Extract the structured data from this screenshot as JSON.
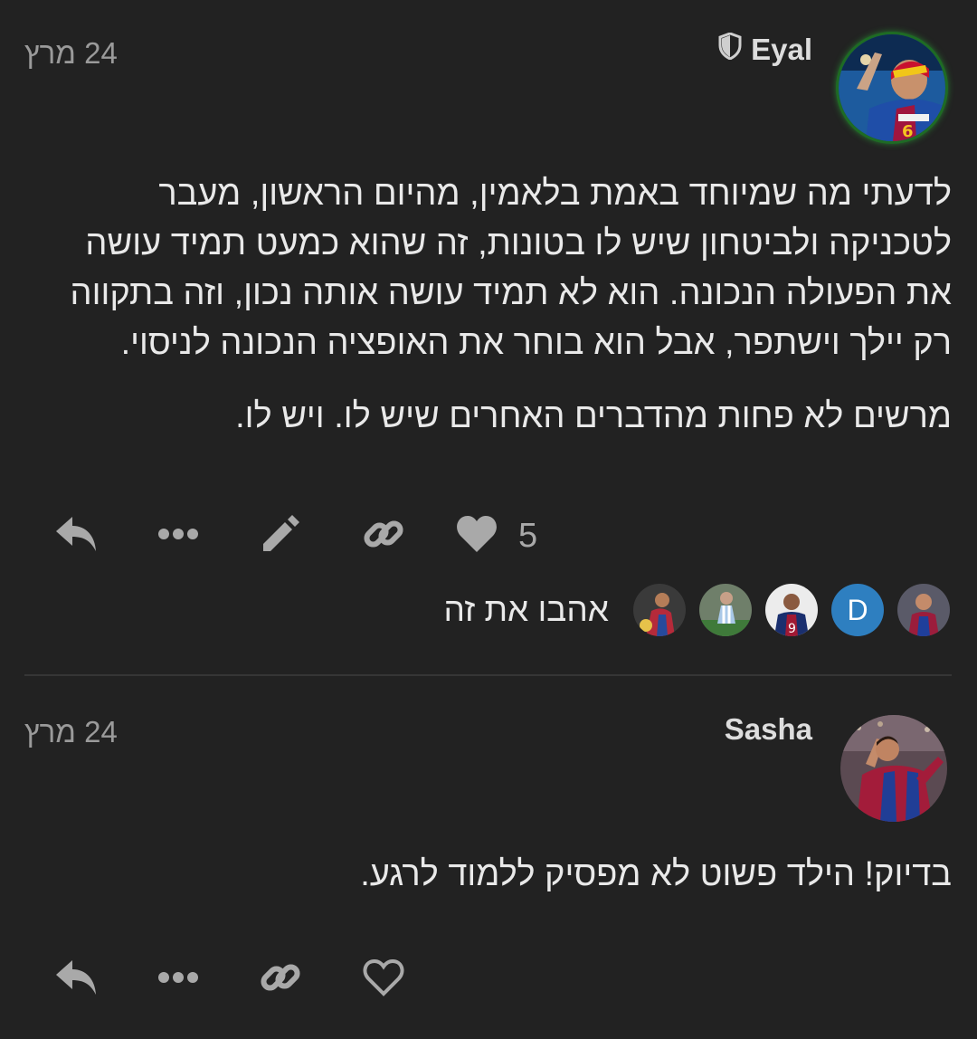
{
  "posts": [
    {
      "username": "Eyal",
      "badge_icon": "shield-icon",
      "date": "24 מרץ",
      "paragraphs": [
        "לדעתי מה שמיוחד באמת בלאמין, מהיום הראשון, מעבר לטכניקה ולביטחון שיש לו בטונות, זה שהוא כמעט תמיד עושה את הפעולה הנכונה. הוא לא תמיד עושה אותה נכון, וזה בתקווה רק יילך וישתפר, אבל הוא בוחר את האופציה הנכונה לניסוי.",
        "מרשים לא פחות מהדברים האחרים שיש לו. ויש לו."
      ],
      "like_count": "5",
      "likers_label": "אהבו את זה",
      "liker_initial": "D"
    },
    {
      "username": "Sasha",
      "date": "24 מרץ",
      "paragraphs": [
        "בדיוק! הילד פשוט לא מפסיק ללמוד לרגע."
      ]
    }
  ],
  "colors": {
    "background": "#222222",
    "text": "#e9e9e9",
    "muted": "#9a9a9a",
    "icon": "#a9a9a9",
    "liker_badge": "#2e7fc0"
  },
  "icons": [
    "reply-icon",
    "more-icon",
    "edit-icon",
    "link-icon",
    "heart-icon",
    "heart-outline-icon",
    "shield-icon"
  ]
}
